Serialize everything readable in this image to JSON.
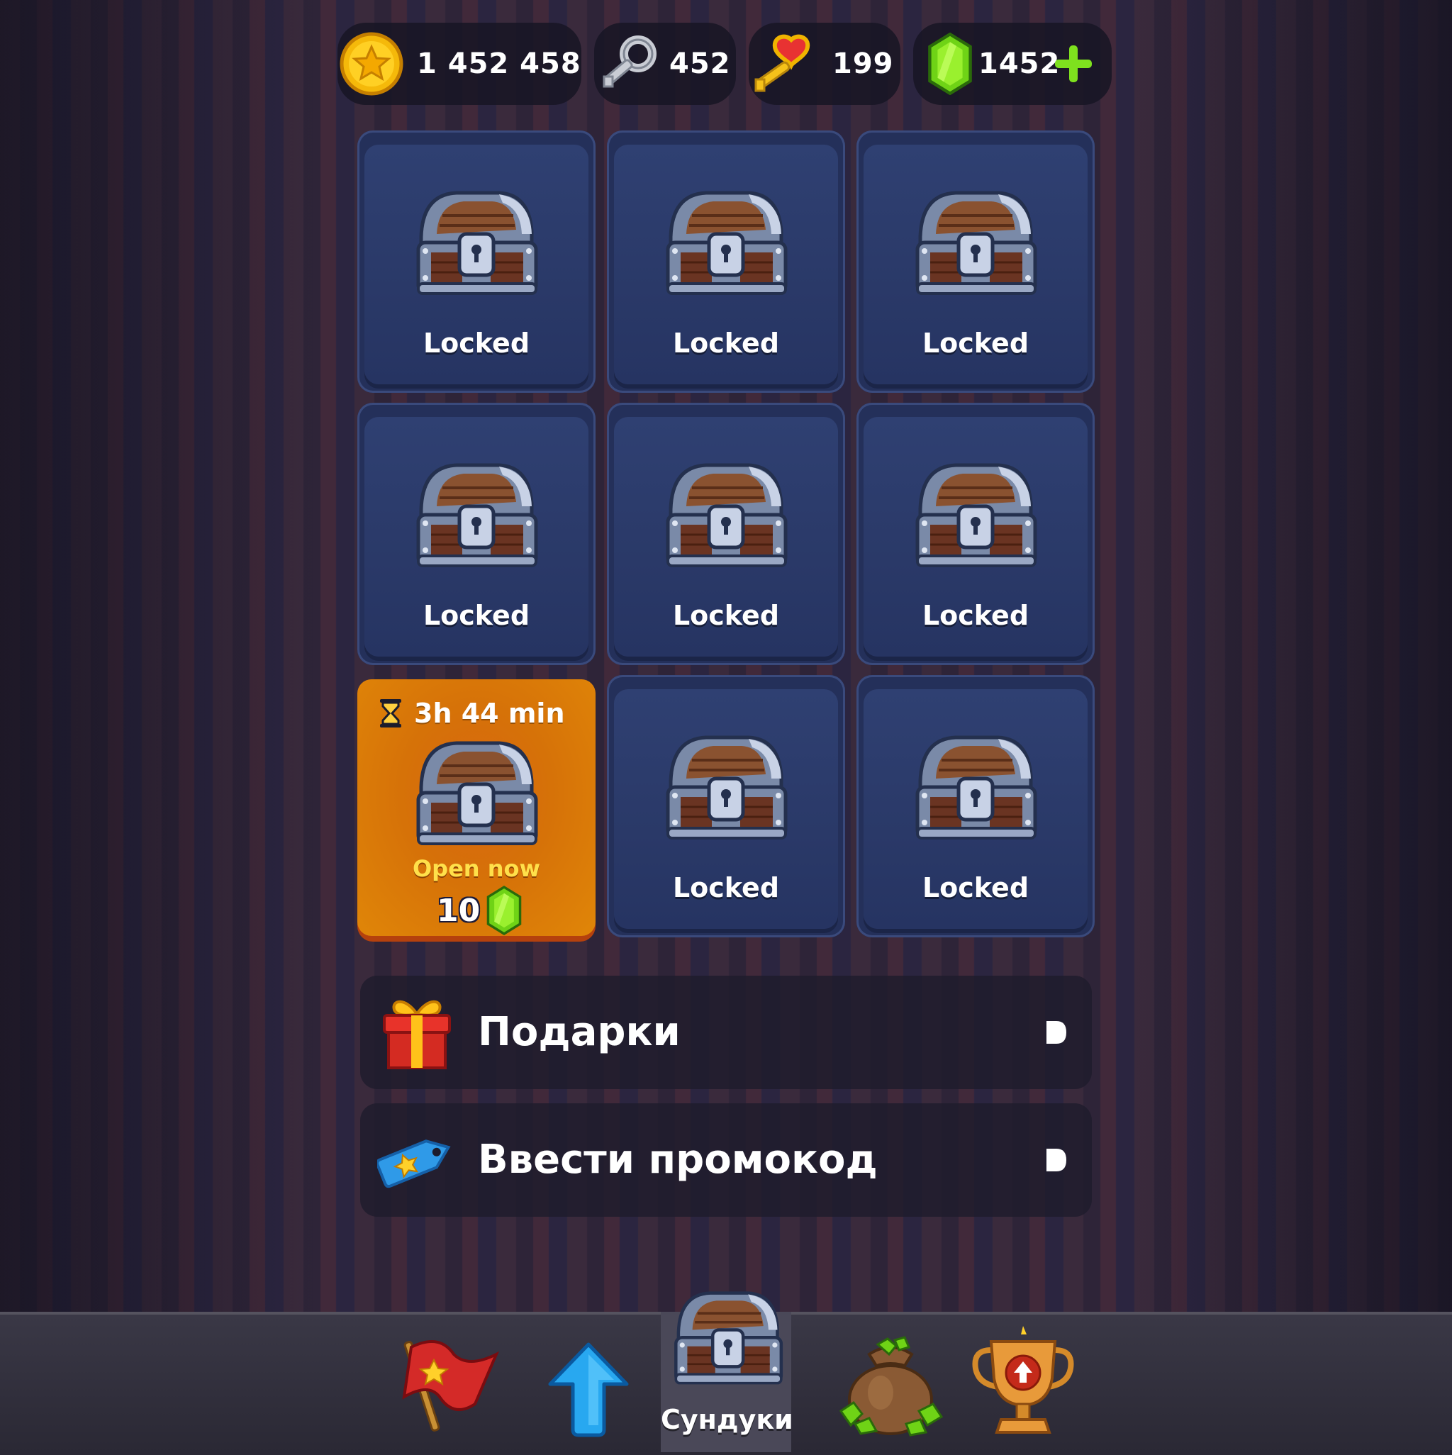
{
  "currencies": {
    "coins": {
      "value": "1 452 458",
      "icon": "gold-star-coin-icon"
    },
    "silver_keys": {
      "value": "452",
      "icon": "silver-key-icon"
    },
    "heart_keys": {
      "value": "199",
      "icon": "heart-key-icon"
    },
    "gems": {
      "value": "1452",
      "icon": "green-gem-icon",
      "add_icon": "plus-icon"
    }
  },
  "chests": [
    {
      "status": "Locked"
    },
    {
      "status": "Locked"
    },
    {
      "status": "Locked"
    },
    {
      "status": "Locked"
    },
    {
      "status": "Locked"
    },
    {
      "status": "Locked"
    },
    {
      "timer": "3h 44 min",
      "action": "Open now",
      "cost": "10",
      "cost_icon": "green-gem-icon"
    },
    {
      "status": "Locked"
    },
    {
      "status": "Locked"
    }
  ],
  "menu": [
    {
      "label": "Подарки",
      "icon": "gift-icon"
    },
    {
      "label": "Ввести промокод",
      "icon": "promo-tag-icon"
    }
  ],
  "nav": {
    "items": [
      {
        "icon": "red-flag-icon"
      },
      {
        "icon": "blue-arrow-up-icon"
      },
      {
        "icon": "chest-icon",
        "label": "Сундуки",
        "active": true
      },
      {
        "icon": "gem-bag-icon"
      },
      {
        "icon": "trophy-icon"
      }
    ]
  },
  "colors": {
    "slot_blue": "#2f4072",
    "slot_active_orange": "#d86610",
    "gem_green": "#7ee11e",
    "open_now_yellow": "#ffe04a"
  }
}
